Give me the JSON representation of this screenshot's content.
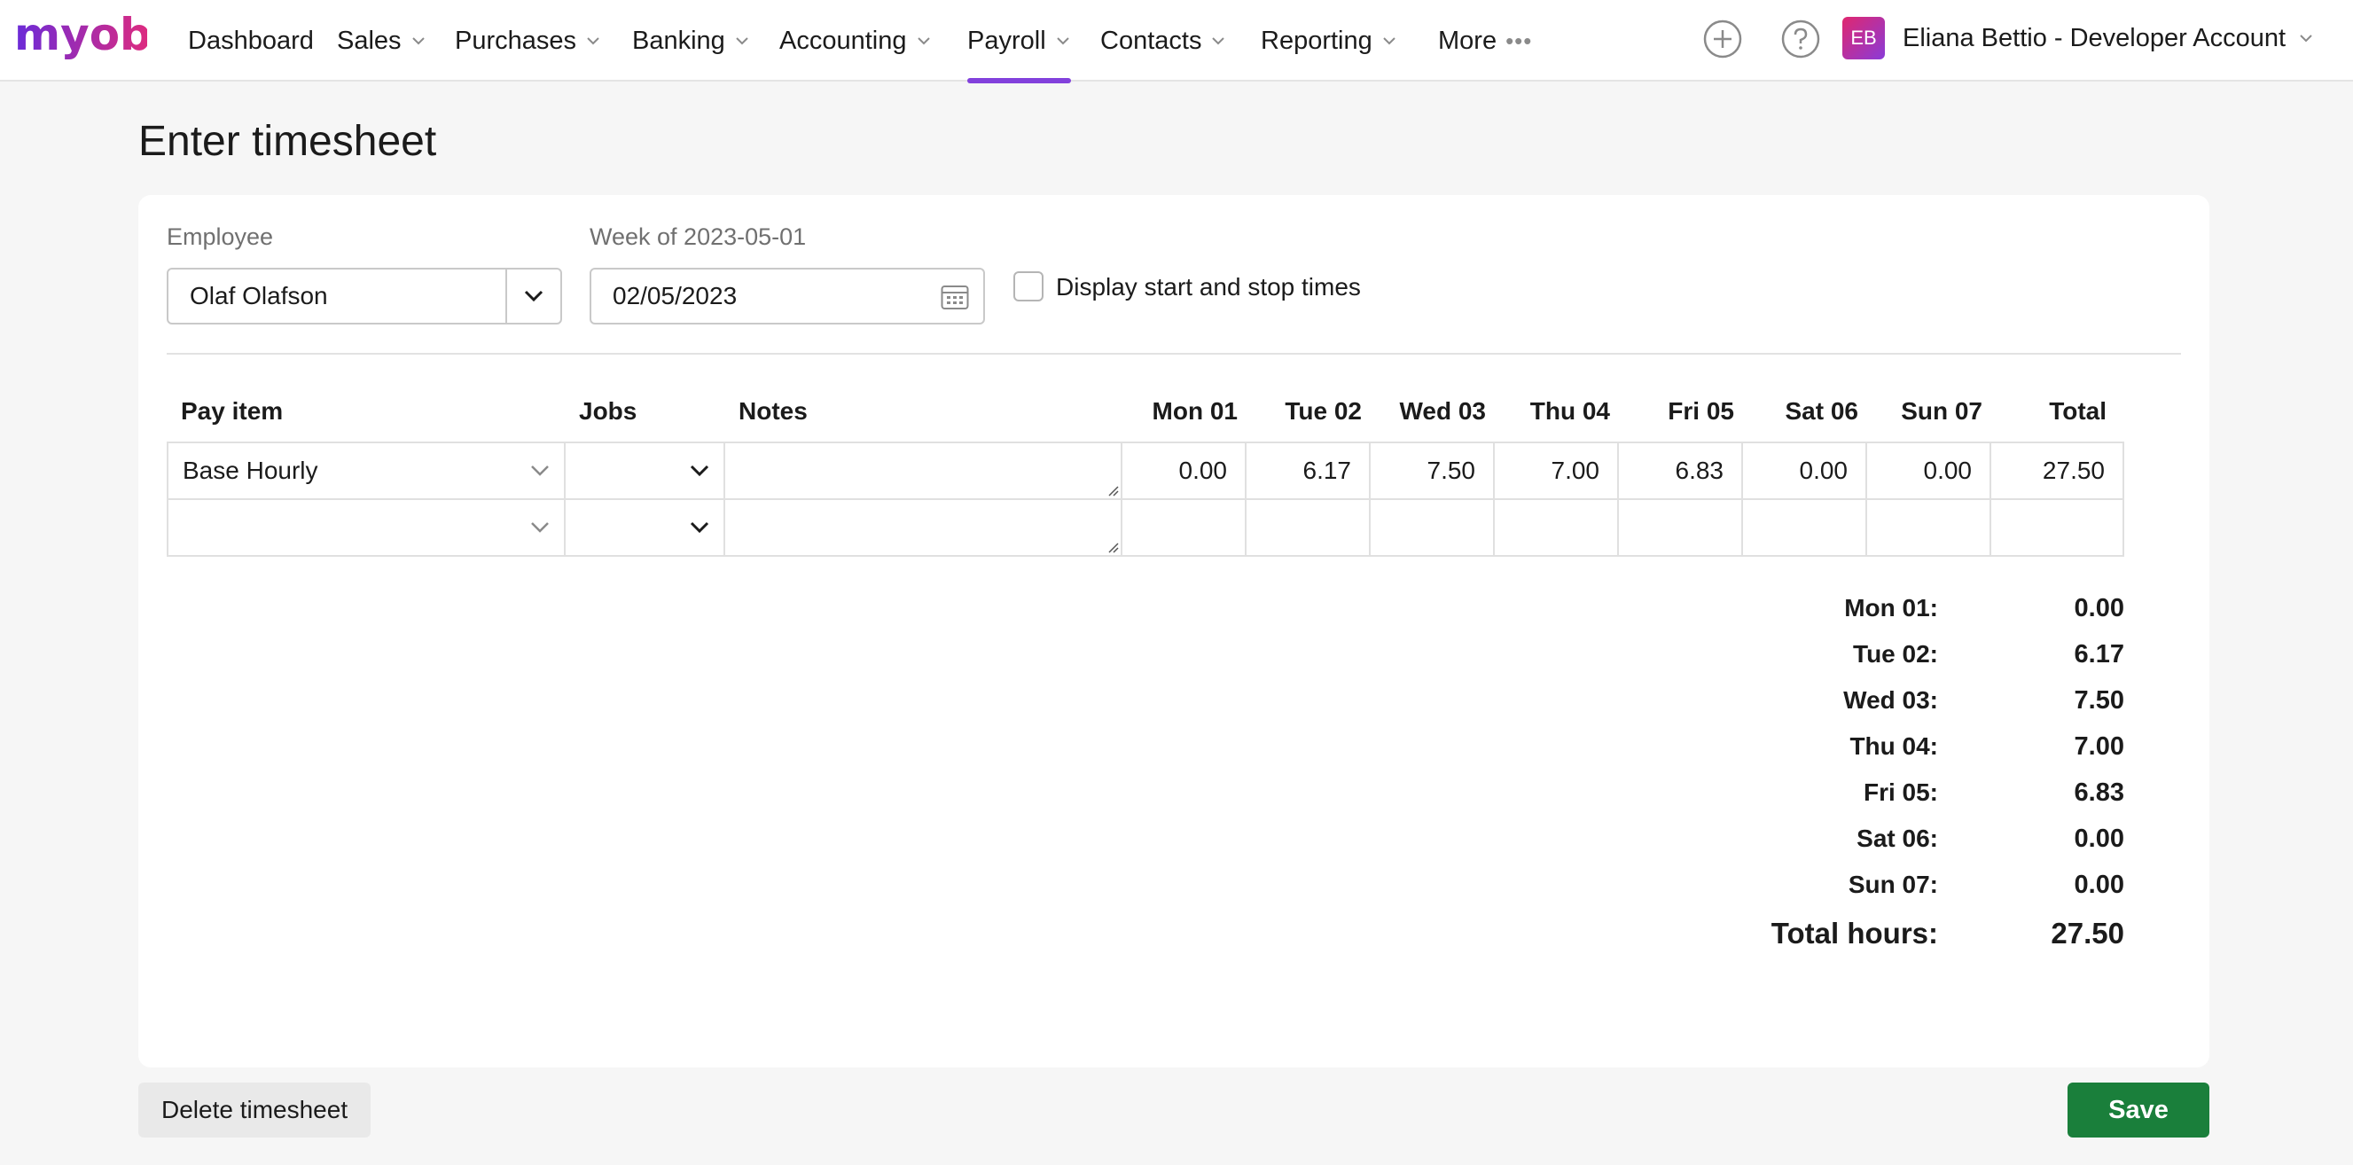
{
  "brand": {
    "logo_text": "myob",
    "accent_color": "#8241dc"
  },
  "nav": {
    "items": [
      {
        "label": "Dashboard",
        "has_chevron": false
      },
      {
        "label": "Sales",
        "has_chevron": true
      },
      {
        "label": "Purchases",
        "has_chevron": true
      },
      {
        "label": "Banking",
        "has_chevron": true
      },
      {
        "label": "Accounting",
        "has_chevron": true
      },
      {
        "label": "Payroll",
        "has_chevron": true,
        "active": true
      },
      {
        "label": "Contacts",
        "has_chevron": true
      },
      {
        "label": "Reporting",
        "has_chevron": true
      },
      {
        "label": "More",
        "has_chevron": false
      }
    ],
    "more_icon": "•••",
    "icons": [
      "add-icon",
      "help-icon"
    ],
    "avatar_initials": "EB",
    "account_label": "Eliana Bettio - Developer Account"
  },
  "page": {
    "title": "Enter timesheet"
  },
  "form": {
    "employee_label": "Employee",
    "employee_value": "Olaf Olafson",
    "week_label": "Week of 2023-05-01",
    "week_value": "02/05/2023",
    "display_times_label": "Display start and stop times",
    "display_times_checked": false
  },
  "grid": {
    "headers": {
      "pay_item": "Pay item",
      "jobs": "Jobs",
      "notes": "Notes",
      "days": [
        "Mon 01",
        "Tue 02",
        "Wed 03",
        "Thu 04",
        "Fri 05",
        "Sat 06",
        "Sun 07"
      ],
      "total": "Total"
    },
    "rows": [
      {
        "pay_item": "Base Hourly",
        "jobs": "",
        "notes": "",
        "hours": [
          "0.00",
          "6.17",
          "7.50",
          "7.00",
          "6.83",
          "0.00",
          "0.00"
        ],
        "total": "27.50"
      },
      {
        "pay_item": "",
        "jobs": "",
        "notes": "",
        "hours": [
          "",
          "",
          "",
          "",
          "",
          "",
          ""
        ],
        "total": ""
      }
    ]
  },
  "totals": {
    "days": [
      {
        "label": "Mon 01:",
        "value": "0.00"
      },
      {
        "label": "Tue 02:",
        "value": "6.17"
      },
      {
        "label": "Wed 03:",
        "value": "7.50"
      },
      {
        "label": "Thu 04:",
        "value": "7.00"
      },
      {
        "label": "Fri 05:",
        "value": "6.83"
      },
      {
        "label": "Sat 06:",
        "value": "0.00"
      },
      {
        "label": "Sun 07:",
        "value": "0.00"
      }
    ],
    "grand_label": "Total hours:",
    "grand_value": "27.50"
  },
  "actions": {
    "delete_label": "Delete timesheet",
    "save_label": "Save",
    "save_color": "#1a7f3b"
  }
}
